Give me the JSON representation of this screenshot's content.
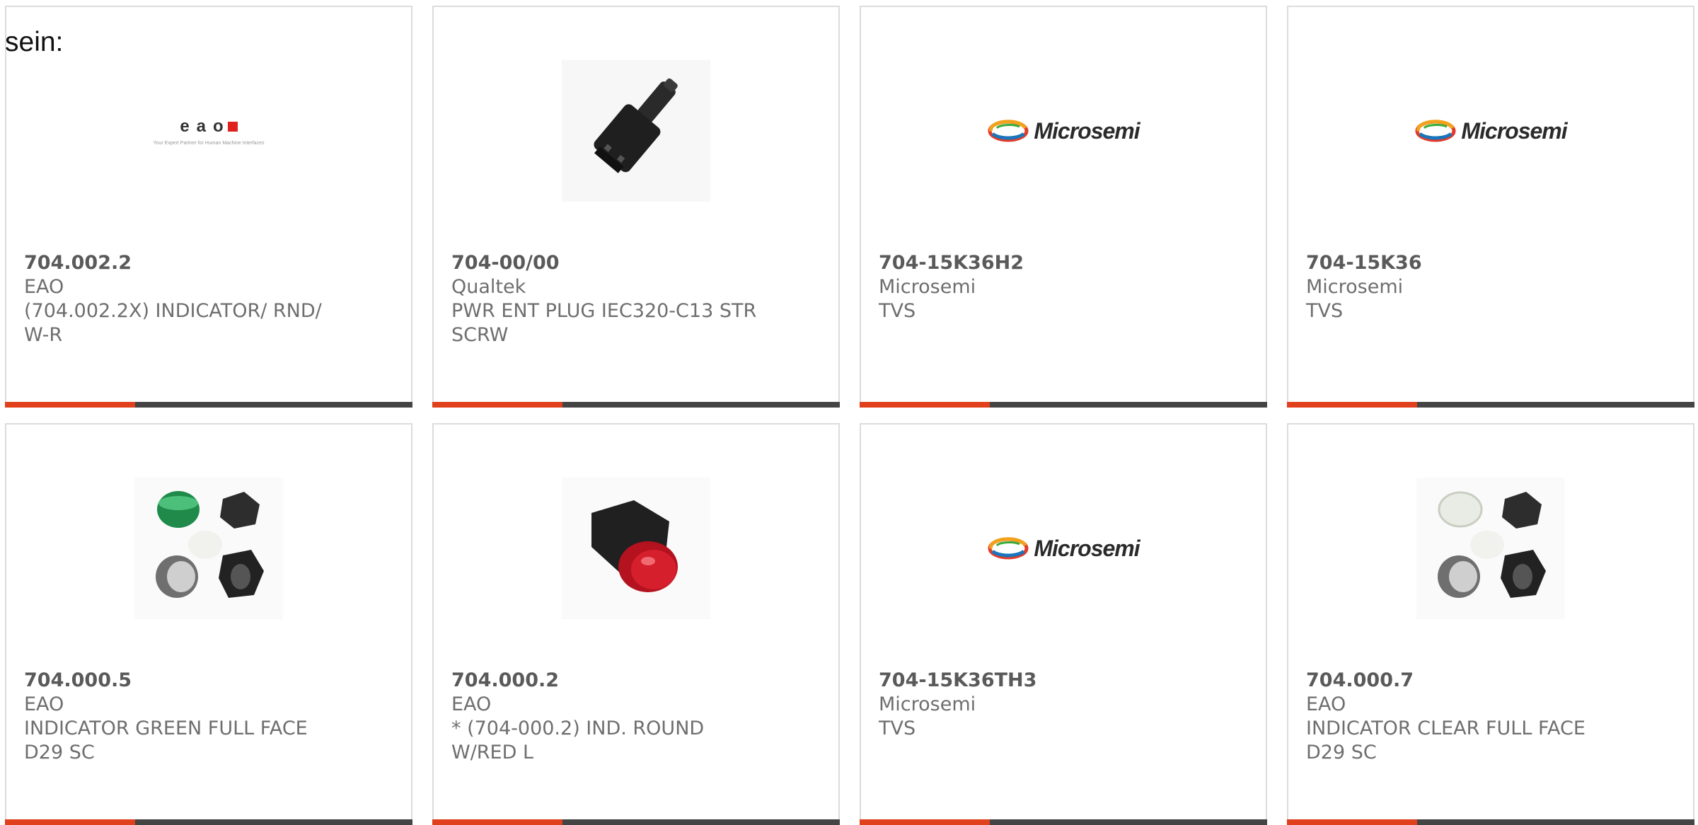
{
  "intro_text": "sein:",
  "colors": {
    "accent": "#e0401c",
    "bar": "#444444",
    "card_border": "#dcdcdc",
    "text": "#6e6e6e"
  },
  "logos": {
    "microsemi": "Microsemi",
    "eao": "eao",
    "eao_tagline": "Your Expert Partner for Human Machine Interfaces"
  },
  "products": [
    {
      "part_number": "704.002.2",
      "manufacturer": "EAO",
      "description_1": "(704.002.2X) INDICATOR/ RND/",
      "description_2": "W-R",
      "image": "eao-logo"
    },
    {
      "part_number": "704-00/00",
      "manufacturer": "Qualtek",
      "description_1": "PWR ENT PLUG IEC320-C13 STR",
      "description_2": "SCRW",
      "image": "iec-plug-photo"
    },
    {
      "part_number": "704-15K36H2",
      "manufacturer": "Microsemi",
      "description_1": "TVS",
      "description_2": "",
      "image": "microsemi-logo"
    },
    {
      "part_number": "704-15K36",
      "manufacturer": "Microsemi",
      "description_1": "TVS",
      "description_2": "",
      "image": "microsemi-logo"
    },
    {
      "part_number": "704.000.5",
      "manufacturer": "EAO",
      "description_1": "INDICATOR GREEN FULL FACE",
      "description_2": "D29 SC",
      "image": "indicator-kit-green-photo"
    },
    {
      "part_number": "704.000.2",
      "manufacturer": "EAO",
      "description_1": "* (704-000.2) IND. ROUND",
      "description_2": "W/RED L",
      "image": "indicator-red-photo"
    },
    {
      "part_number": "704-15K36TH3",
      "manufacturer": "Microsemi",
      "description_1": "TVS",
      "description_2": "",
      "image": "microsemi-logo"
    },
    {
      "part_number": "704.000.7",
      "manufacturer": "EAO",
      "description_1": "INDICATOR CLEAR FULL FACE",
      "description_2": "D29 SC",
      "image": "indicator-kit-clear-photo"
    }
  ]
}
